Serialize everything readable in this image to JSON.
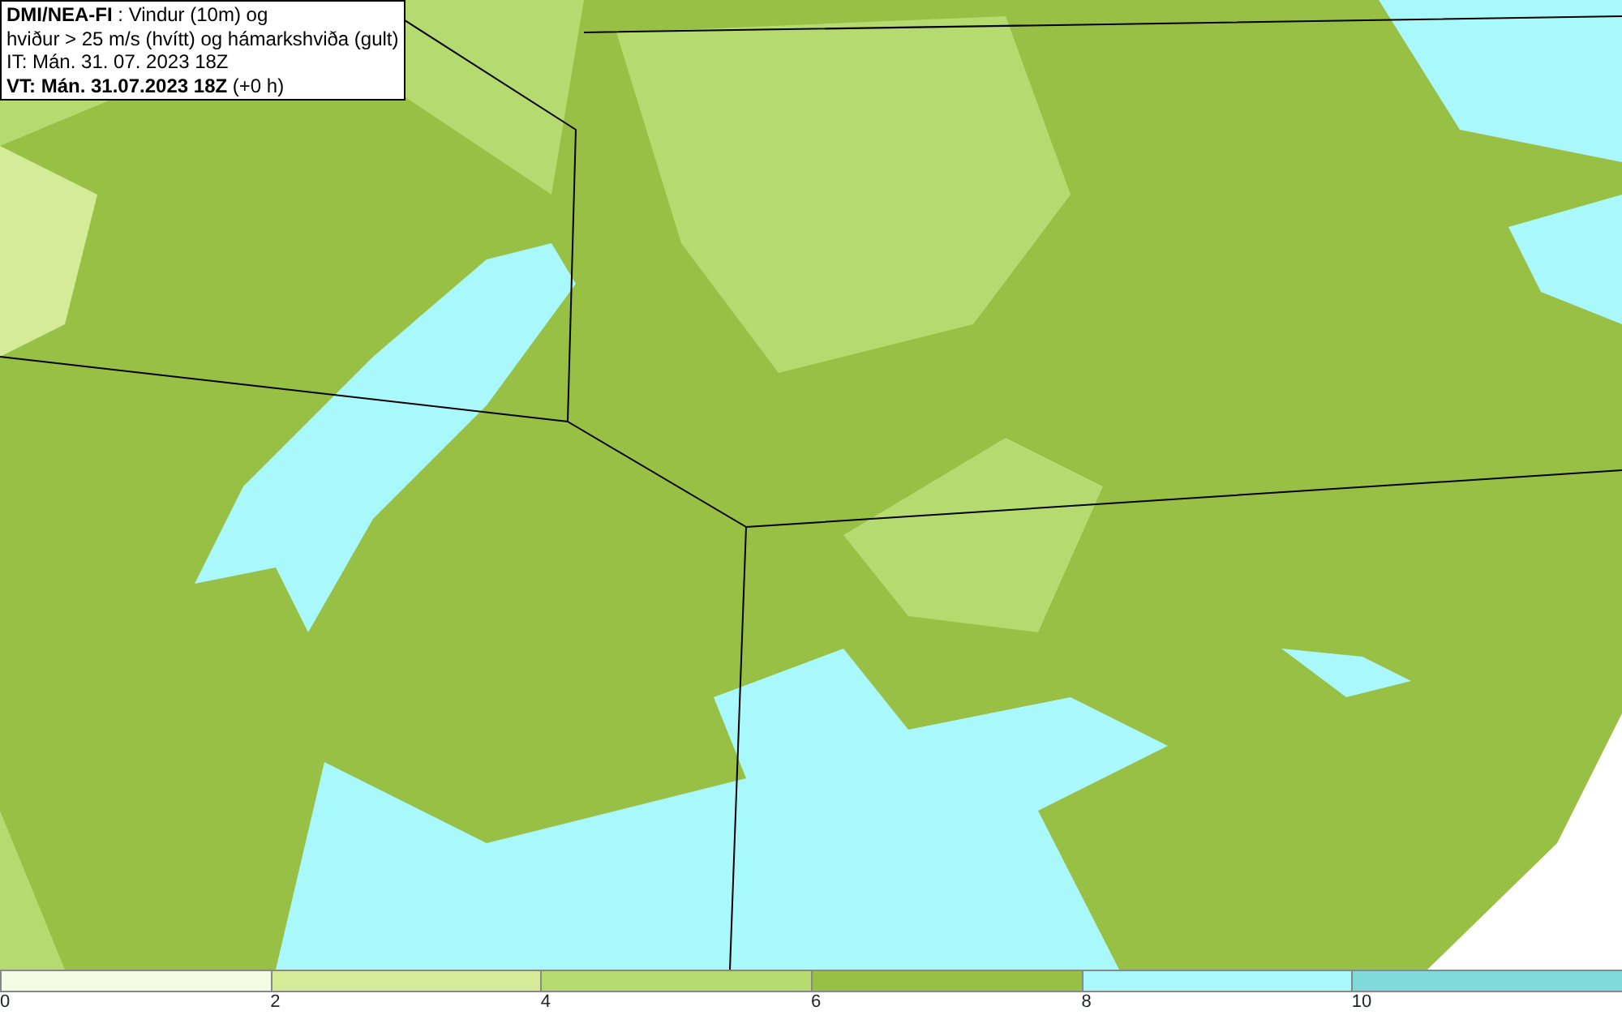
{
  "header": {
    "lines": [
      "**DMI/NEA-FI** : Vindur (10m) og",
      "hviður > 25 m/s (hvítt) og hámarkshviða (gult)",
      "IT: Mán. 31. 07. 2023 18Z",
      "**VT: Mán. 31.07.2023 18Z** (+0 h)"
    ]
  },
  "legend": {
    "segments": [
      {
        "color": "#f4fbe2"
      },
      {
        "color": "#d4ec98"
      },
      {
        "color": "#b5da6f"
      },
      {
        "color": "#98c045"
      },
      {
        "color": "#a9f8fb"
      },
      {
        "color": "#80d9db"
      }
    ],
    "ticks": [
      "0",
      "2",
      "4",
      "6",
      "8",
      "10"
    ]
  }
}
